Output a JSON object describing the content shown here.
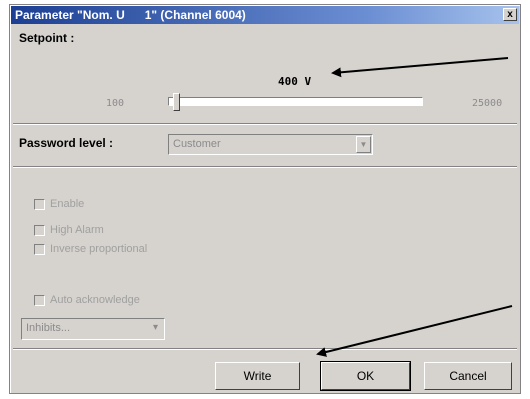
{
  "window": {
    "title": "Parameter \"Nom. U      1\" (Channel 6004)",
    "close_label": "x"
  },
  "setpoint": {
    "label": "Setpoint :",
    "value": "400 V",
    "min_label": "100",
    "max_label": "25000",
    "value_fraction": 0.012
  },
  "password_level": {
    "label": "Password level :",
    "selected": "Customer",
    "arrow": "▼"
  },
  "options": [
    {
      "label": "Enable"
    },
    {
      "label": "High Alarm"
    },
    {
      "label": "Inverse proportional"
    }
  ],
  "auto_acknowledge": {
    "label": "Auto acknowledge",
    "select_value": "Inhibits...",
    "arrow": "▾"
  },
  "buttons": {
    "write": "Write",
    "ok": "OK",
    "cancel": "Cancel"
  },
  "annotation_arrows": [
    {
      "name": "setpoint-arrow"
    },
    {
      "name": "ok-arrow"
    }
  ]
}
